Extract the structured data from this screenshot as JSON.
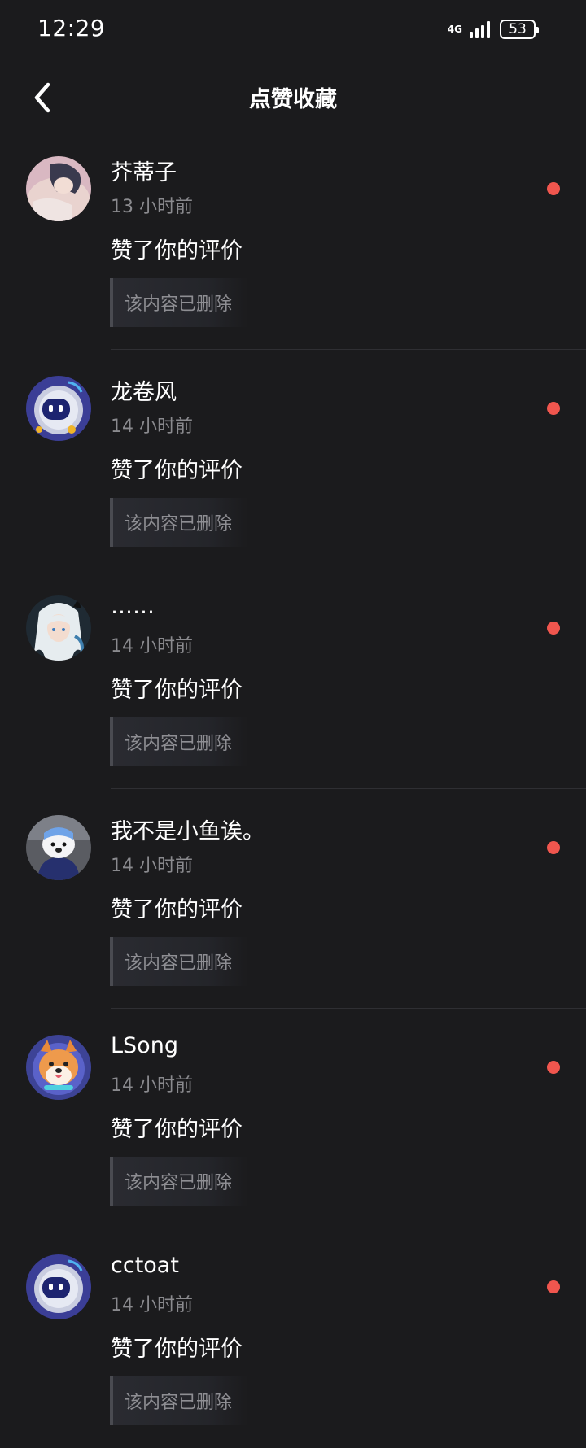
{
  "status_bar": {
    "time": "12:29",
    "network": "4G",
    "battery": "53"
  },
  "header": {
    "title": "点赞收藏",
    "back_icon": "chevron-left-icon"
  },
  "notifications": [
    {
      "name": "芥蒂子",
      "time": "13 小时前",
      "action": "赞了你的评价",
      "quote": "该内容已删除",
      "unread": true,
      "avatar": "anime-sleeping-avatar"
    },
    {
      "name": "龙卷风",
      "time": "14 小时前",
      "action": "赞了你的评价",
      "quote": "该内容已删除",
      "unread": true,
      "avatar": "robot-avatar"
    },
    {
      "name": "……",
      "time": "14 小时前",
      "action": "赞了你的评价",
      "quote": "该内容已删除",
      "unread": true,
      "avatar": "anime-white-hair-avatar"
    },
    {
      "name": "我不是小鱼诶。",
      "time": "14 小时前",
      "action": "赞了你的评价",
      "quote": "该内容已删除",
      "unread": true,
      "avatar": "plush-dog-avatar"
    },
    {
      "name": "LSong",
      "time": "14 小时前",
      "action": "赞了你的评价",
      "quote": "该内容已删除",
      "unread": true,
      "avatar": "shiba-avatar"
    },
    {
      "name": "cctoat",
      "time": "14 小时前",
      "action": "赞了你的评价",
      "quote": "该内容已删除",
      "unread": true,
      "avatar": "robot-avatar"
    }
  ],
  "colors": {
    "background": "#1b1b1d",
    "unread_dot": "#f0564e",
    "secondary_text": "#8a8a8e"
  }
}
